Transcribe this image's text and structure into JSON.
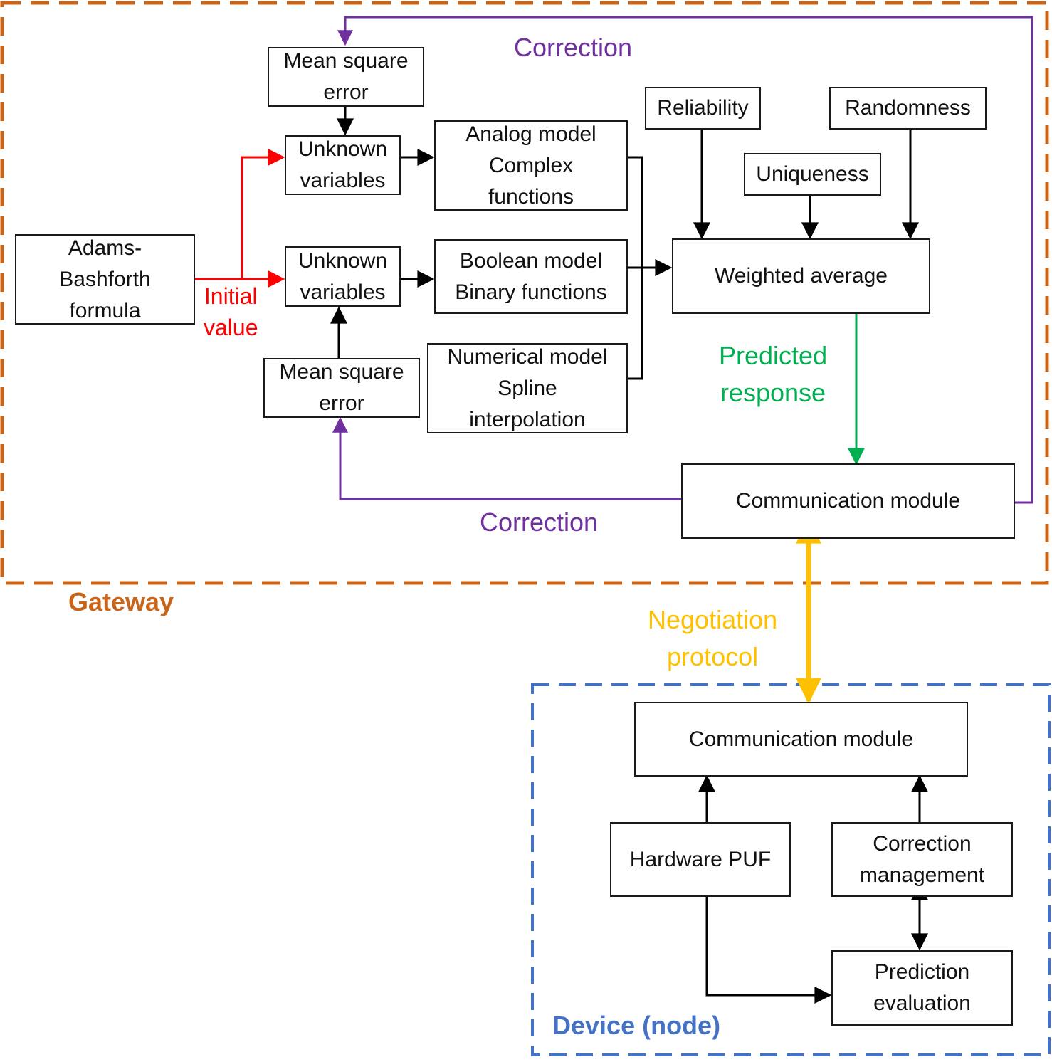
{
  "colors": {
    "gateway": "#C8651B",
    "device": "#4472C4",
    "correction": "#7030A0",
    "initial": "#FF0000",
    "predicted": "#00B050",
    "negotiation": "#FFC000",
    "line": "#000000"
  },
  "regions": {
    "gateway": "Gateway",
    "device": "Device (node)"
  },
  "nodes": {
    "mse_top": [
      "Mean square",
      "error"
    ],
    "unknown_top": [
      "Unknown",
      "variables"
    ],
    "adams": [
      "Adams-",
      "Bashforth",
      "formula"
    ],
    "unknown_bottom": [
      "Unknown",
      "variables"
    ],
    "mse_bottom": [
      "Mean square",
      "error"
    ],
    "analog": [
      "Analog model",
      "Complex",
      "functions"
    ],
    "boolean": [
      "Boolean model",
      "Binary functions"
    ],
    "numerical": [
      "Numerical model",
      "Spline",
      "interpolation"
    ],
    "reliability": [
      "Reliability"
    ],
    "uniqueness": [
      "Uniqueness"
    ],
    "randomness": [
      "Randomness"
    ],
    "weighted": [
      "Weighted average"
    ],
    "comm_gateway": [
      "Communication module"
    ],
    "comm_device": [
      "Communication module"
    ],
    "hardware_puf": [
      "Hardware PUF"
    ],
    "correction_mgmt": [
      "Correction",
      "management"
    ],
    "prediction_eval": [
      "Prediction",
      "evaluation"
    ]
  },
  "edge_labels": {
    "correction_top": "Correction",
    "correction_bottom": "Correction",
    "initial_value": [
      "Initial",
      "value"
    ],
    "predicted_response": [
      "Predicted",
      "response"
    ],
    "negotiation_protocol": [
      "Negotiation",
      "protocol"
    ]
  }
}
